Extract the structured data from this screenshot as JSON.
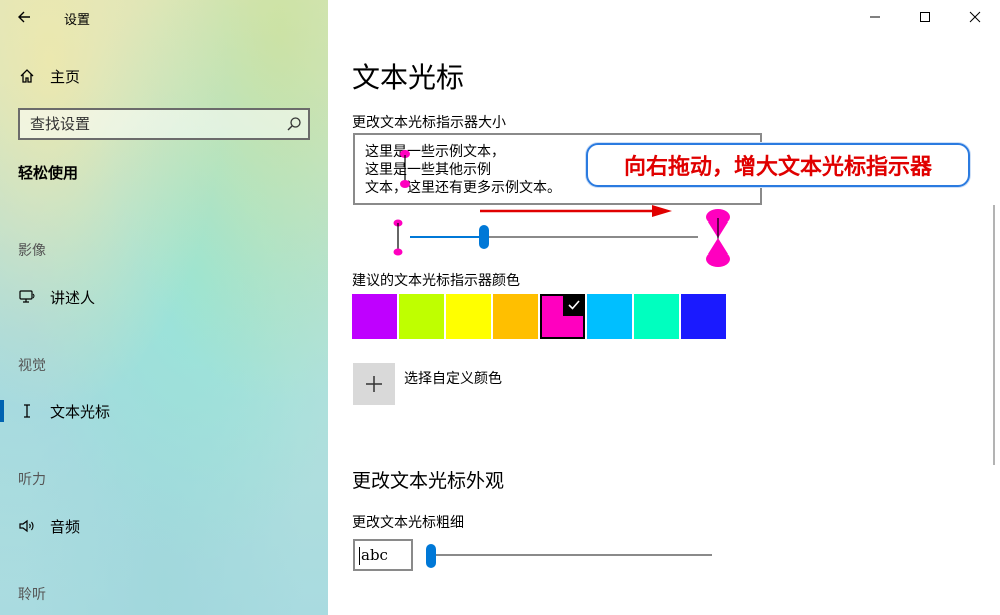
{
  "window": {
    "title": "设置"
  },
  "sidebar": {
    "home_label": "主页",
    "search_placeholder": "查找设置",
    "category_title": "轻松使用",
    "groups": [
      {
        "label": "影像",
        "items": [
          {
            "label": "讲述人",
            "icon": "narrator-icon"
          }
        ]
      },
      {
        "label": "视觉",
        "items": [
          {
            "label": "文本光标",
            "icon": "text-cursor-icon",
            "active": true
          }
        ]
      },
      {
        "label": "听力",
        "items": [
          {
            "label": "音频",
            "icon": "speaker-icon"
          }
        ]
      },
      {
        "label": "聆听",
        "items": []
      }
    ]
  },
  "main": {
    "page_title": "文本光标",
    "size_section": {
      "label": "更改文本光标指示器大小",
      "preview_lines": [
        "这里是一些示例文本，",
        "这里是一些其他示例",
        "文本，这里还有更多示例文本。"
      ],
      "slider_value_fraction": 0.25
    },
    "color_section": {
      "label": "建议的文本光标指示器颜色",
      "swatches": [
        "#bf00ff",
        "#bfff00",
        "#ffff00",
        "#ffbf00",
        "#ff00bf",
        "#00bfff",
        "#00ffbf",
        "#1a1aff"
      ],
      "selected_index": 4,
      "custom_color_label": "选择自定义颜色"
    },
    "appearance_section": {
      "title": "更改文本光标外观",
      "thickness_label": "更改文本光标粗细",
      "preview_text": "abc",
      "thickness_value_fraction": 0.0
    }
  },
  "annotation": {
    "text": "向右拖动，增大文本光标指示器"
  },
  "colors": {
    "accent": "#0078d7",
    "annotation_text": "#e00000",
    "annotation_border": "#2b7be0",
    "cursor_indicator": "#ff00bf"
  }
}
